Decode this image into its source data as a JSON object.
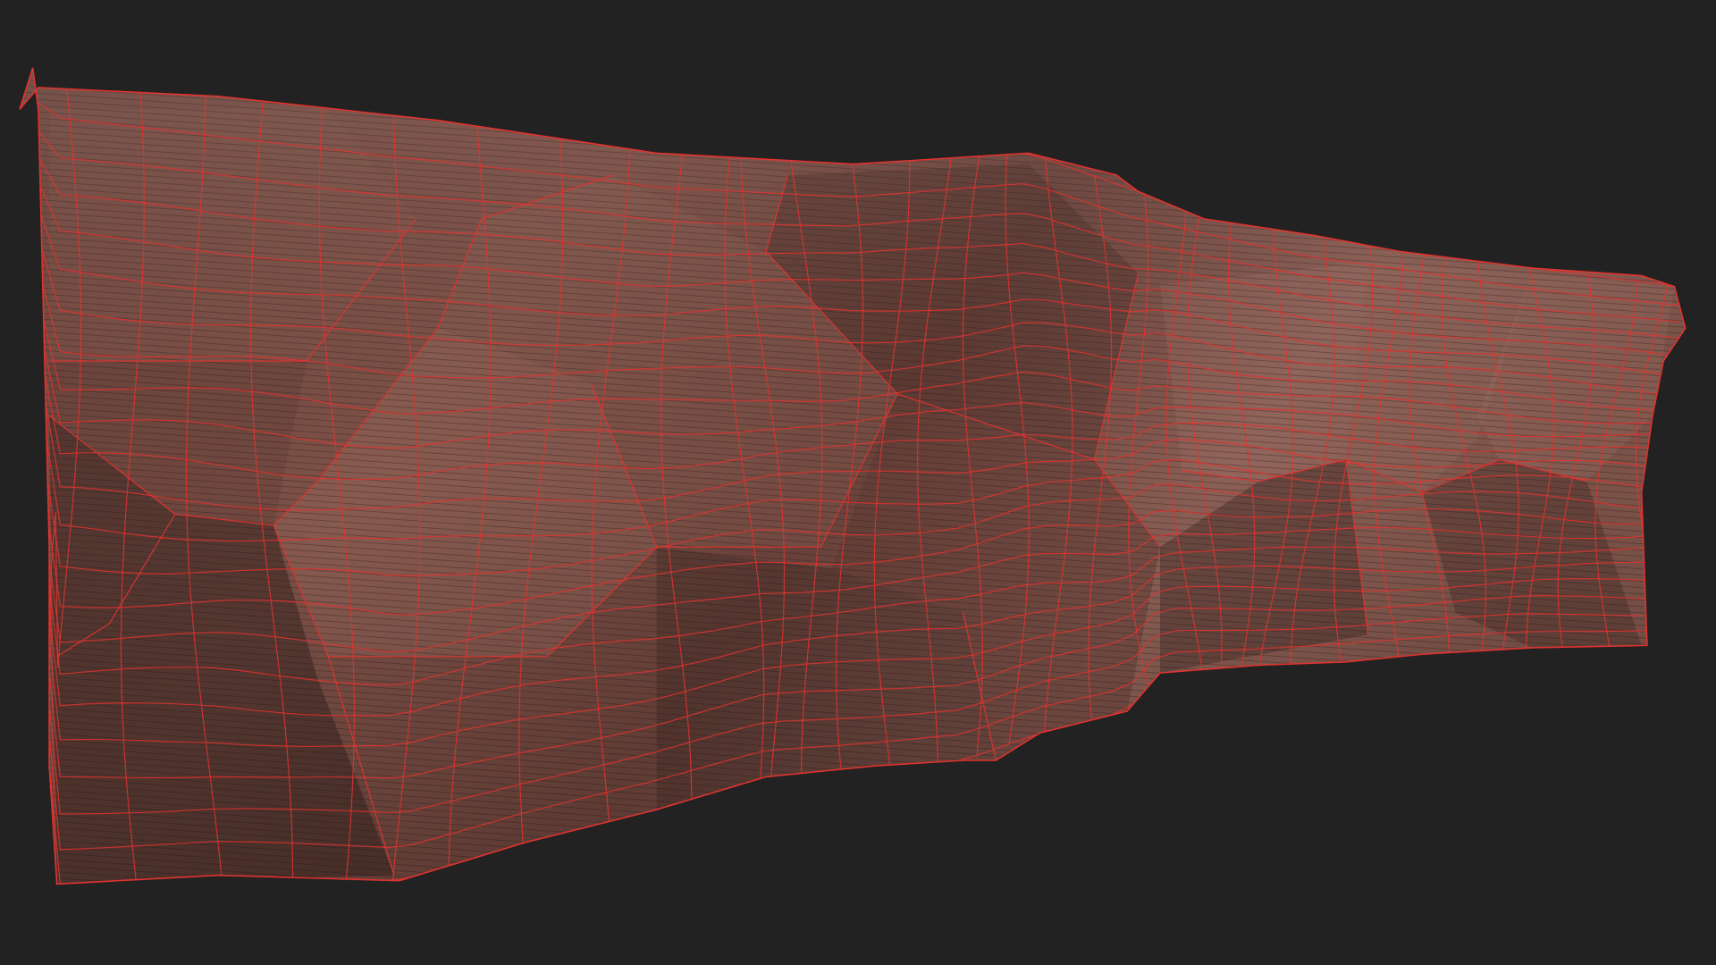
{
  "viewport": {
    "subject": "rock-cliff-mesh",
    "render_mode": "textured-with-wireframe-overlay",
    "background_color": "#222222",
    "wireframe_color": "#e0332f",
    "rock_base_color": "#7a4a40",
    "rock_highlight_color": "#b07f72",
    "rock_shadow_color": "#3a2622"
  }
}
